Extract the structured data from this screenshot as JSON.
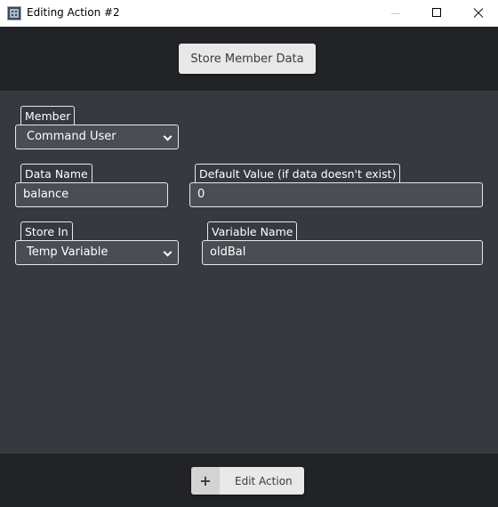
{
  "window": {
    "title": "Editing Action #2",
    "icons": {
      "app": "app-icon",
      "minimize": "minimize-icon",
      "maximize": "maximize-icon",
      "close": "close-icon"
    }
  },
  "header": {
    "action_button_label": "Store Member Data"
  },
  "form": {
    "member": {
      "label": "Member",
      "value": "Command User"
    },
    "data_name": {
      "label": "Data Name",
      "value": "balance"
    },
    "default_value": {
      "label": "Default Value (if data doesn't exist)",
      "value": "0"
    },
    "store_in": {
      "label": "Store In",
      "value": "Temp Variable"
    },
    "variable_name": {
      "label": "Variable Name",
      "value": "oldBal"
    }
  },
  "footer": {
    "edit_icon": "+",
    "edit_label": "Edit Action"
  }
}
